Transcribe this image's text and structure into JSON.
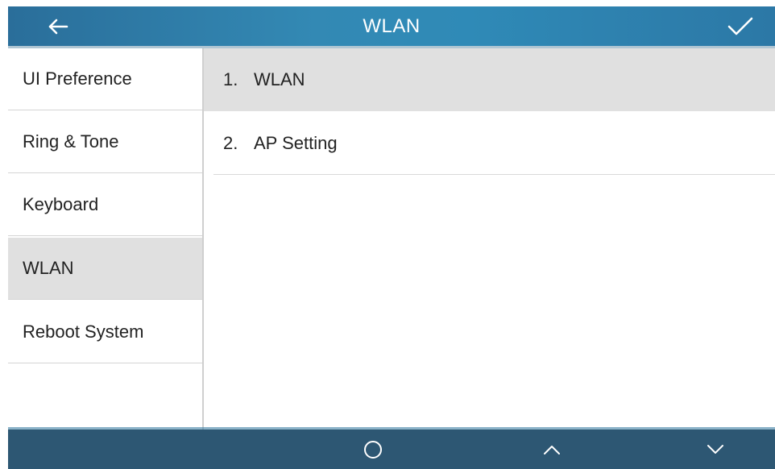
{
  "header": {
    "title": "WLAN",
    "back_icon": "arrow-left-icon",
    "confirm_icon": "checkmark-icon",
    "background": "#3389b4"
  },
  "sidebar": {
    "items": [
      {
        "label": "UI Preference",
        "active": false
      },
      {
        "label": "Ring & Tone",
        "active": false
      },
      {
        "label": "Keyboard",
        "active": false
      },
      {
        "label": "WLAN",
        "active": true
      },
      {
        "label": "Reboot System",
        "active": false
      }
    ],
    "active_color": "#e0e0e0"
  },
  "content": {
    "items": [
      {
        "number": "1.",
        "label": "WLAN",
        "selected": true
      },
      {
        "number": "2.",
        "label": "AP Setting",
        "selected": false
      }
    ]
  },
  "footer": {
    "background": "#2d5773",
    "softkeys": [
      {
        "icon": "circle-icon"
      },
      {
        "icon": "chevron-up-icon"
      },
      {
        "icon": "chevron-down-icon"
      }
    ]
  }
}
